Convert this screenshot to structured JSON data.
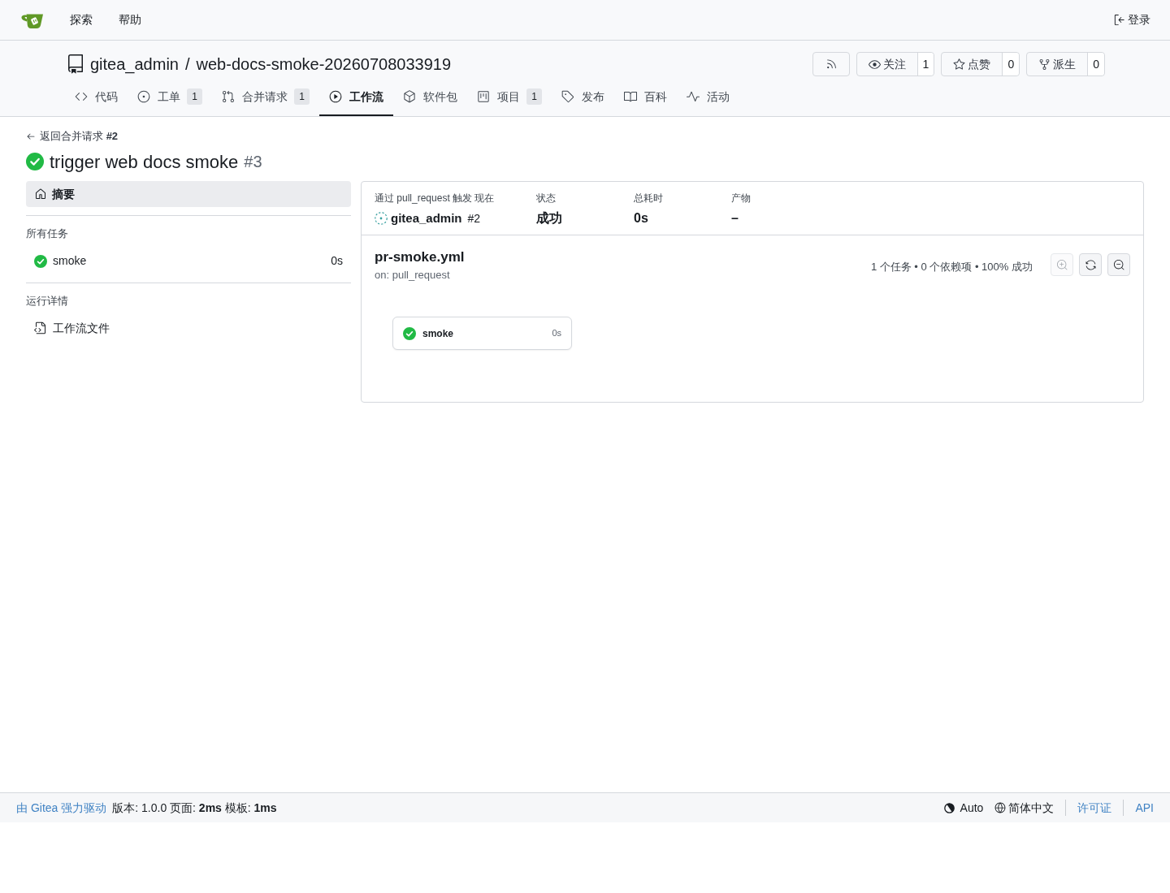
{
  "navbar": {
    "items": [
      {
        "label": "探索"
      },
      {
        "label": "帮助"
      }
    ],
    "sign_in": "登录"
  },
  "repo": {
    "owner": "gitea_admin",
    "separator": "/",
    "name": "web-docs-smoke-20260708033919",
    "actions": [
      {
        "kind": "rss"
      },
      {
        "kind": "watch",
        "label": "关注",
        "count": "1"
      },
      {
        "kind": "star",
        "label": "点赞",
        "count": "0"
      },
      {
        "kind": "fork",
        "label": "派生",
        "count": "0"
      }
    ]
  },
  "tabs": [
    {
      "kind": "code",
      "label": "代码",
      "selected": false
    },
    {
      "kind": "issues",
      "label": "工单",
      "count": "1",
      "selected": false
    },
    {
      "kind": "pulls",
      "label": "合并请求",
      "count": "1",
      "selected": false
    },
    {
      "kind": "actions",
      "label": "工作流",
      "selected": true
    },
    {
      "kind": "packages",
      "label": "软件包",
      "selected": false
    },
    {
      "kind": "projects",
      "label": "项目",
      "count": "1",
      "selected": false
    },
    {
      "kind": "releases",
      "label": "发布",
      "selected": false
    },
    {
      "kind": "wiki",
      "label": "百科",
      "selected": false
    },
    {
      "kind": "activity",
      "label": "活动",
      "selected": false
    }
  ],
  "run": {
    "back_link": "返回合并请求 **#2**",
    "title": "trigger web docs smoke",
    "number": "#3",
    "succeeded": true
  },
  "sidebar": {
    "summary": {
      "label": "摘要",
      "selected": true
    },
    "jobs_heading": "所有任务",
    "jobs": [
      {
        "name": "smoke",
        "duration": "0s",
        "succeeded": true,
        "selected": false
      }
    ],
    "details_heading": "运行详情",
    "details_links": [
      {
        "label": "工作流文件"
      }
    ]
  },
  "panel": {
    "trigger": {
      "label": "通过 pull_request 触发 现在",
      "user": "gitea_admin",
      "pr": "#2"
    },
    "stats": [
      {
        "label": "状态",
        "value": "成功"
      },
      {
        "label": "总耗时",
        "value": "0s"
      },
      {
        "label": "产物",
        "value": "–"
      }
    ],
    "workflow": {
      "file": "pr-smoke.yml",
      "event": "on: pull_request",
      "summary": "1 个任务 • 0 个依赖项 • 100% 成功",
      "controls": [
        {
          "kind": "zoom-in",
          "disabled": true
        },
        {
          "kind": "reset",
          "disabled": false
        },
        {
          "kind": "zoom-out",
          "disabled": false
        }
      ]
    },
    "graph": {
      "nodes": [
        {
          "name": "smoke",
          "duration": "0s",
          "succeeded": true
        }
      ]
    }
  },
  "footer": {
    "powered_by": "由 Gitea 强力驱动",
    "info": "版本: 1.0.0 页面: **2ms** 模板: **1ms**",
    "theme": "Auto",
    "language": "简体中文",
    "links": [
      {
        "label": "许可证"
      },
      {
        "label": "API"
      }
    ]
  }
}
